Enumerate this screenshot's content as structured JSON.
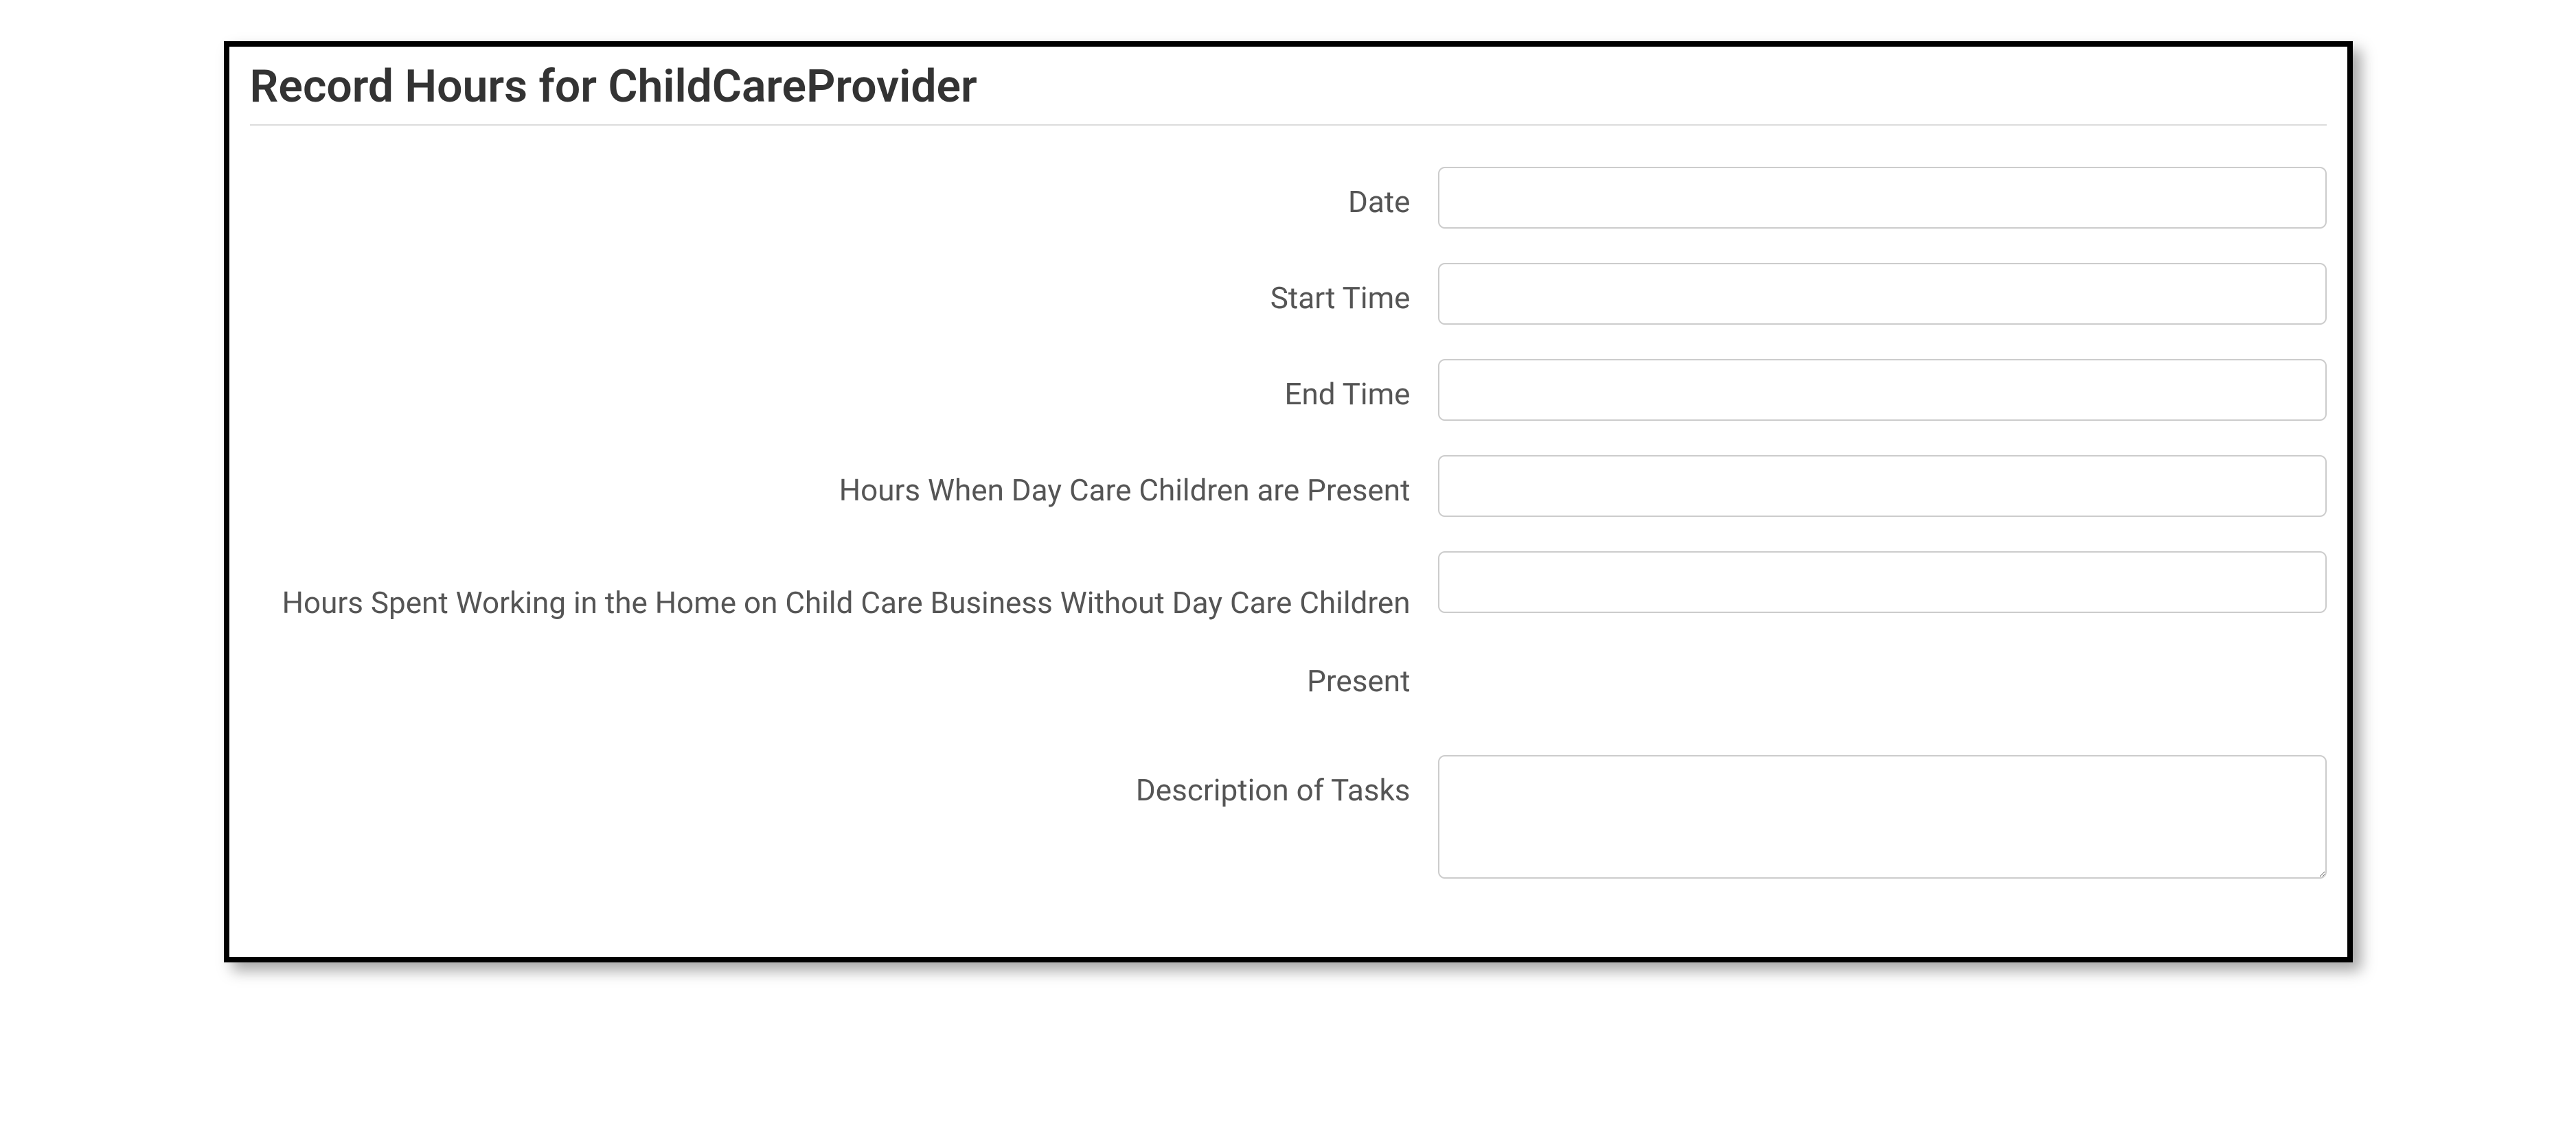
{
  "form": {
    "title": "Record Hours for ChildCareProvider",
    "fields": {
      "date": {
        "label": "Date",
        "value": ""
      },
      "start_time": {
        "label": "Start Time",
        "value": ""
      },
      "end_time": {
        "label": "End Time",
        "value": ""
      },
      "hours_children_present": {
        "label": "Hours When Day Care Children are Present",
        "value": ""
      },
      "hours_children_absent": {
        "label": "Hours Spent Working in the Home on Child Care Business Without Day Care Children Present",
        "value": ""
      },
      "description": {
        "label": "Description of Tasks",
        "value": ""
      }
    }
  }
}
